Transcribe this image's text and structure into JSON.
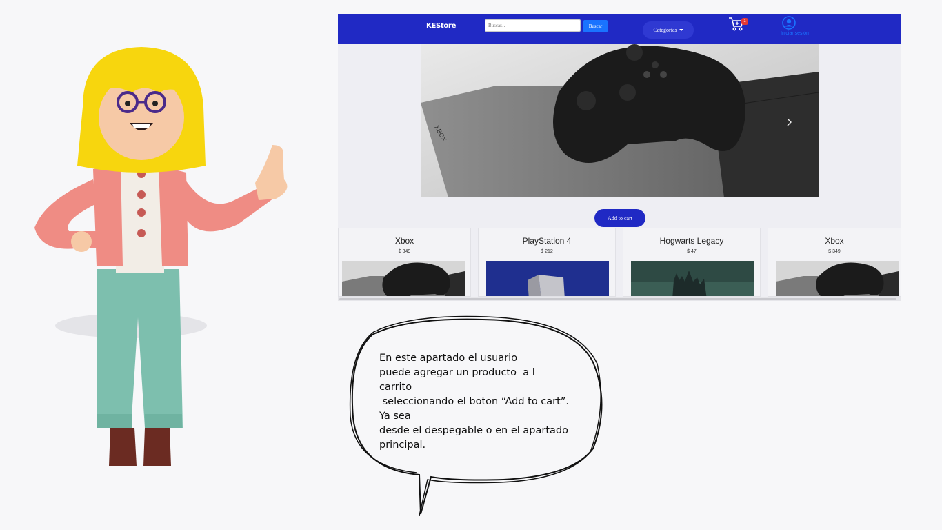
{
  "navbar": {
    "brand": "KEStore",
    "search_placeholder": "Buscar...",
    "search_button": "Buscar",
    "categories_button": "Categorias",
    "cart_count": "1",
    "login_link": "Iniciar sesión"
  },
  "hero": {
    "slides_count": 6,
    "active_slide": 1
  },
  "add_to_cart_label": "Add to cart",
  "products": [
    {
      "title": "Xbox",
      "price": "$ 349"
    },
    {
      "title": "PlayStation 4",
      "price": "$ 212"
    },
    {
      "title": "Hogwarts Legacy",
      "price": "$ 47"
    },
    {
      "title": "Xbox",
      "price": "$ 349"
    }
  ],
  "bubble": {
    "lines": [
      "En este apartado el usuario",
      "puede agregar un producto  a l",
      "carrito",
      " seleccionando el boton “Add to cart”.",
      "Ya sea",
      "desde el despegable o en el apartado",
      "principal."
    ]
  },
  "colors": {
    "navbar": "#2029c4",
    "button_blue": "#1a73ff",
    "badge_red": "#e53935"
  }
}
